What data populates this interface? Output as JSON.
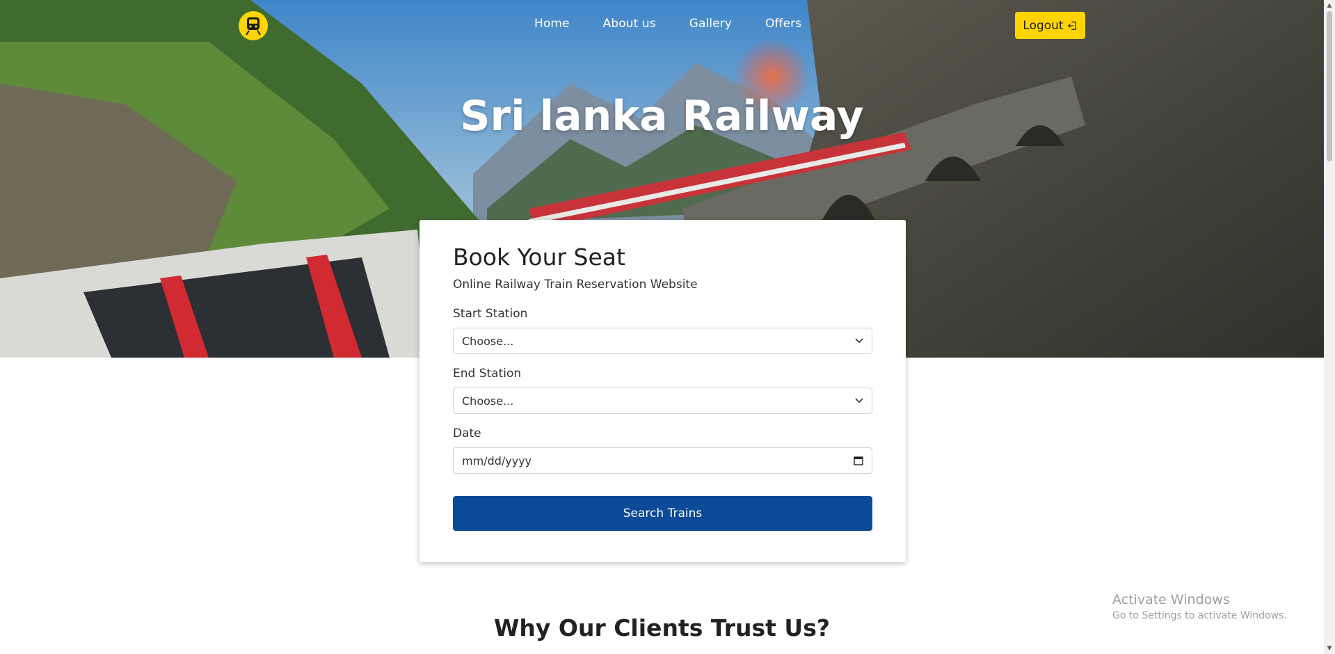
{
  "nav": {
    "items": [
      "Home",
      "About us",
      "Gallery",
      "Offers"
    ],
    "logout_label": "Logout"
  },
  "hero": {
    "title": "Sri lanka Railway"
  },
  "booking": {
    "title": "Book Your Seat",
    "subtitle": "Online Railway Train Reservation Website",
    "start_label": "Start Station",
    "start_value": "Choose...",
    "end_label": "End Station",
    "end_value": "Choose...",
    "date_label": "Date",
    "date_placeholder": "mm/dd/yyyy",
    "search_label": "Search Trains"
  },
  "section": {
    "trust_title": "Why Our Clients Trust Us?"
  },
  "watermark": {
    "line1": "Activate Windows",
    "line2": "Go to Settings to activate Windows."
  },
  "colors": {
    "accent_yellow": "#ffd400",
    "primary_blue": "#0b4a96"
  },
  "icons": {
    "logo": "train-icon",
    "logout": "logout-icon",
    "select": "chevron-down-icon",
    "date": "calendar-icon"
  }
}
